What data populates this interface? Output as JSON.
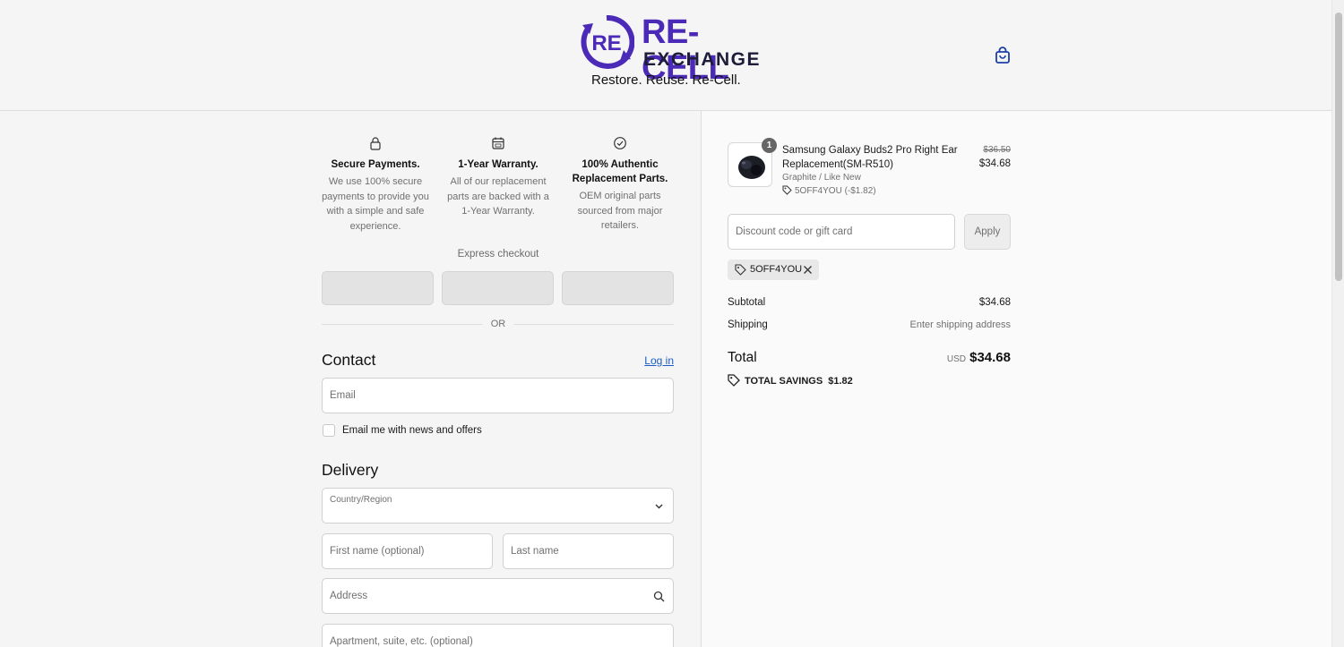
{
  "brand": {
    "logo_mark": "RE",
    "name": "RE-CELL",
    "sub": "EXCHANGE",
    "tagline": "Restore. Reuse. Re-Cell."
  },
  "header": {
    "cart_icon": "shopping-bag-icon"
  },
  "features": [
    {
      "icon": "lock-icon",
      "title": "Secure Payments.",
      "desc": "We use 100% secure payments to provide you with a simple and safe experience."
    },
    {
      "icon": "calendar-icon",
      "title": "1-Year Warranty.",
      "desc": "All of our replacement parts are backed with a 1-Year Warranty."
    },
    {
      "icon": "check-circle-icon",
      "title": "100% Authentic Replacement Parts.",
      "desc": "OEM original parts sourced from major retailers."
    }
  ],
  "express": {
    "label": "Express checkout",
    "or": "OR"
  },
  "contact": {
    "title": "Contact",
    "login": "Log in",
    "email_placeholder": "Email",
    "newsletter_label": "Email me with news and offers"
  },
  "delivery": {
    "title": "Delivery",
    "country_label": "Country/Region",
    "first_name_placeholder": "First name (optional)",
    "last_name_placeholder": "Last name",
    "address_placeholder": "Address",
    "apartment_placeholder": "Apartment, suite, etc. (optional)"
  },
  "order": {
    "item": {
      "quantity": "1",
      "name": "Samsung Galaxy Buds2 Pro Right Ear Replacement(SM-R510)",
      "variant": "Graphite / Like New",
      "discount": "5OFF4YOU (-$1.82)",
      "price_original": "$36.50",
      "price": "$34.68"
    },
    "discount_placeholder": "Discount code or gift card",
    "apply": "Apply",
    "applied_code": "5OFF4YOU",
    "subtotal_label": "Subtotal",
    "subtotal": "$34.68",
    "shipping_label": "Shipping",
    "shipping": "Enter shipping address",
    "total_label": "Total",
    "currency": "USD",
    "total": "$34.68",
    "savings_label": "TOTAL SAVINGS",
    "savings": "$1.82"
  },
  "colors": {
    "brand_purple": "#4b2ab8",
    "link_blue": "#1a5bc4",
    "accent_dark": "#1d1d3a"
  }
}
